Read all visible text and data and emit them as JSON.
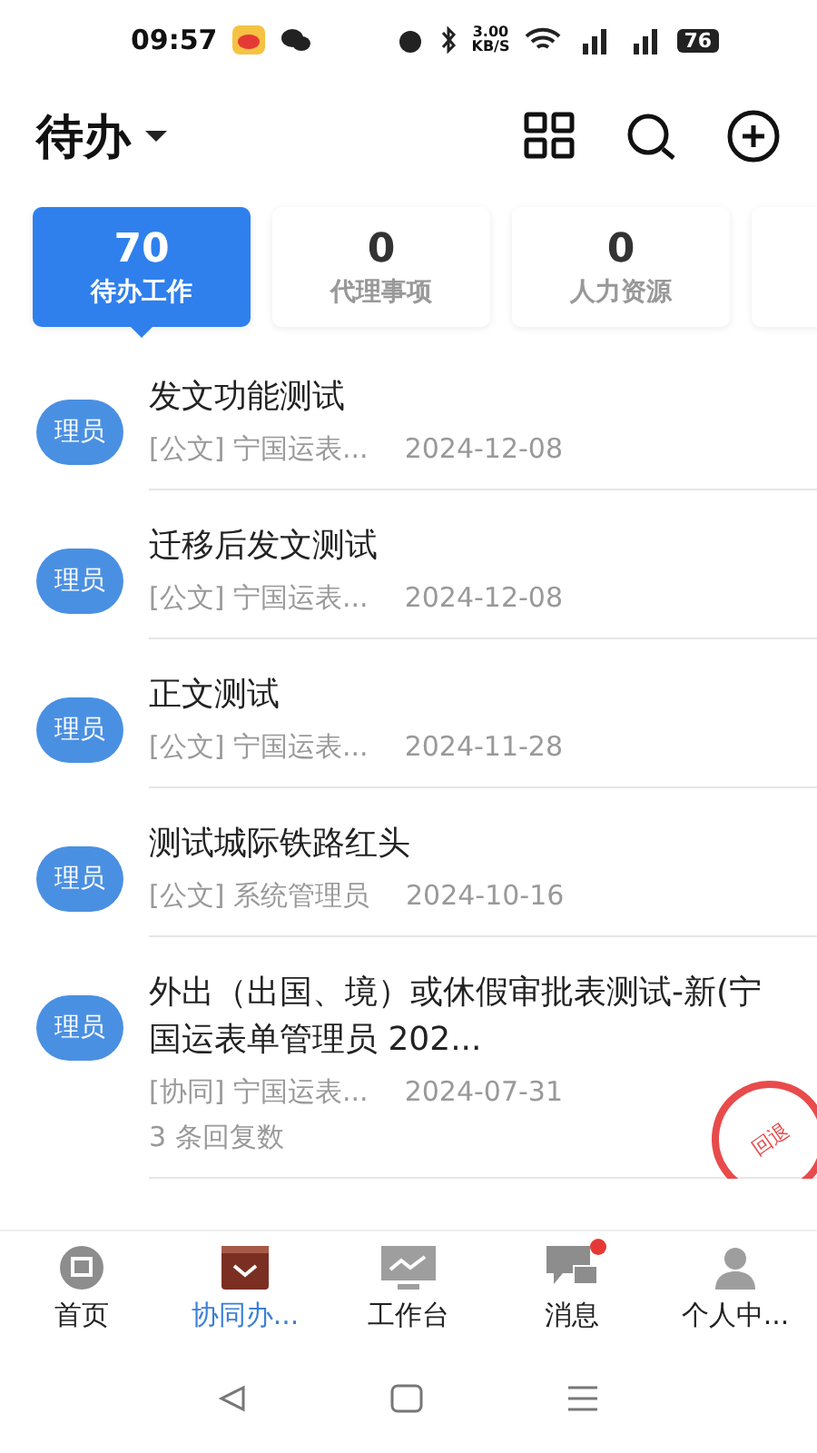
{
  "status_bar": {
    "time": "09:57",
    "speed": "3.00",
    "speed_unit": "KB/S",
    "battery": "76"
  },
  "header": {
    "title": "待办"
  },
  "summary_cards": [
    {
      "count": "70",
      "label": "待办工作",
      "selected": true
    },
    {
      "count": "0",
      "label": "代理事项",
      "selected": false
    },
    {
      "count": "0",
      "label": "人力资源",
      "selected": false
    },
    {
      "selected": false
    }
  ],
  "items": [
    {
      "avatar": "理员",
      "title": "发文功能测试",
      "category": "[公文]",
      "sender": "宁国运表...",
      "date": "2024-12-08"
    },
    {
      "avatar": "理员",
      "title": "迁移后发文测试",
      "category": "[公文]",
      "sender": "宁国运表...",
      "date": "2024-12-08"
    },
    {
      "avatar": "理员",
      "title": "正文测试",
      "category": "[公文]",
      "sender": "宁国运表...",
      "date": "2024-11-28"
    },
    {
      "avatar": "理员",
      "title": "测试城际铁路红头",
      "category": "[公文]",
      "sender": "系统管理员",
      "date": "2024-10-16"
    },
    {
      "avatar": "理员",
      "title": "外出（出国、境）或休假审批表测试-新(宁国运表单管理员 202...",
      "category": "[协同]",
      "sender": "宁国运表...",
      "date": "2024-07-31",
      "replies": "3 条回复数",
      "stamp": "回退"
    }
  ],
  "tab_bar": [
    {
      "label": "首页",
      "selected": false,
      "badge": false
    },
    {
      "label": "协同办...",
      "selected": true,
      "badge": false
    },
    {
      "label": "工作台",
      "selected": false,
      "badge": false
    },
    {
      "label": "消息",
      "selected": false,
      "badge": true
    },
    {
      "label": "个人中...",
      "selected": false,
      "badge": false
    }
  ]
}
